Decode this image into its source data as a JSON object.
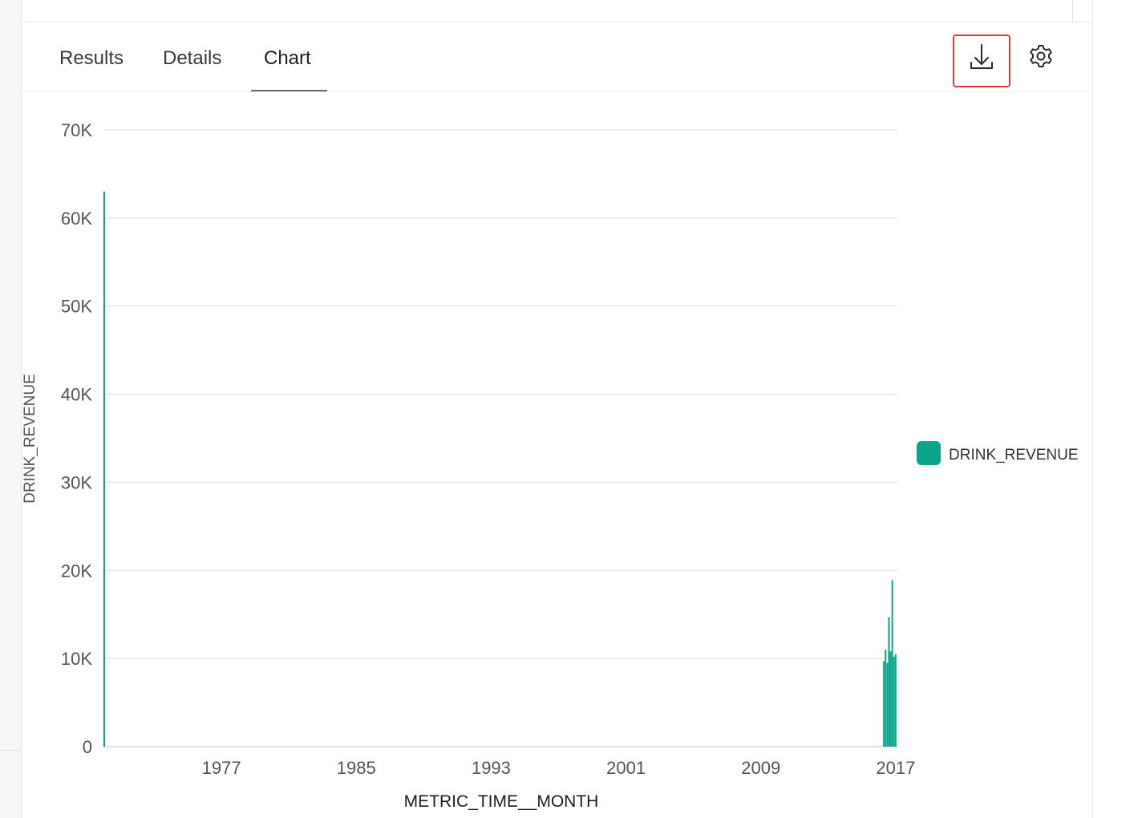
{
  "tabs": [
    {
      "label": "Results",
      "active": false
    },
    {
      "label": "Details",
      "active": false
    },
    {
      "label": "Chart",
      "active": true
    }
  ],
  "toolbar": {
    "download_icon": "download-icon",
    "settings_icon": "gear-icon"
  },
  "colors": {
    "series": "#0aa68a",
    "highlight_border": "#e23b3b"
  },
  "chart_data": {
    "type": "bar",
    "xlabel": "METRIC_TIME__MONTH",
    "ylabel": "DRINK_REVENUE",
    "x_ticks": [
      "1977",
      "1985",
      "1993",
      "2001",
      "2009",
      "2017"
    ],
    "y_ticks": [
      "0",
      "10K",
      "20K",
      "30K",
      "40K",
      "50K",
      "60K",
      "70K"
    ],
    "xlim": [
      1970,
      2017.1
    ],
    "ylim": [
      0,
      70000
    ],
    "grid": true,
    "legend": {
      "position": "right",
      "entries": [
        "DRINK_REVENUE"
      ]
    },
    "series": [
      {
        "name": "DRINK_REVENUE",
        "points": [
          {
            "x": 1970.0,
            "y": 63000
          },
          {
            "x": 2016.25,
            "y": 9700
          },
          {
            "x": 2016.35,
            "y": 11000
          },
          {
            "x": 2016.45,
            "y": 9500
          },
          {
            "x": 2016.55,
            "y": 14700
          },
          {
            "x": 2016.65,
            "y": 10800
          },
          {
            "x": 2016.75,
            "y": 18900
          },
          {
            "x": 2016.85,
            "y": 10200
          },
          {
            "x": 2016.95,
            "y": 10500
          }
        ]
      }
    ]
  }
}
